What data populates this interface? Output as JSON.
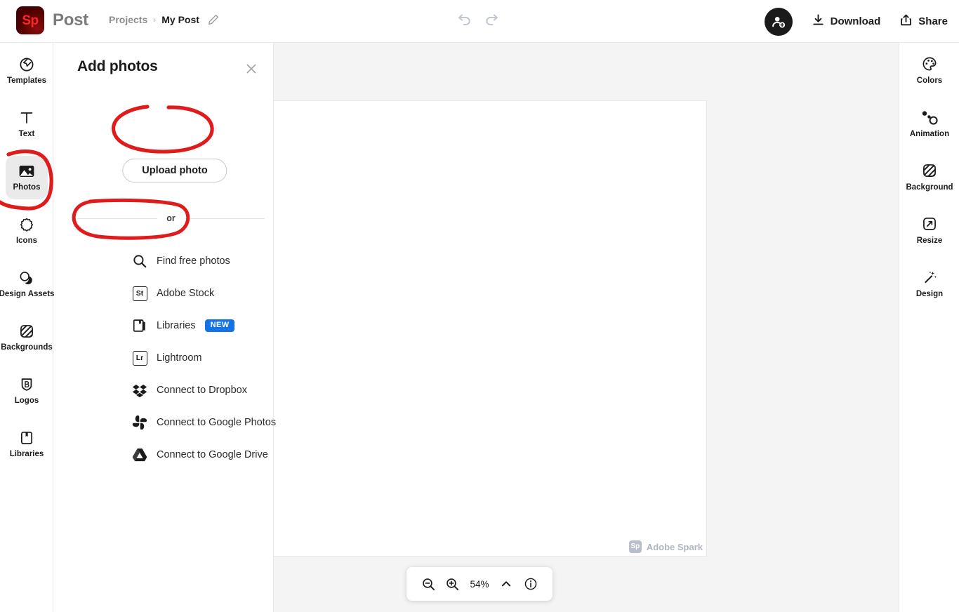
{
  "app": {
    "logo_text": "Sp",
    "brand_name": "Post",
    "logo_color": "#4d0000",
    "accent_color": "#fa2727"
  },
  "breadcrumb": {
    "root": "Projects",
    "separator": "›",
    "current": "My Post",
    "edit_icon": "pencil-icon"
  },
  "history": {
    "undo_icon": "undo-arrow-icon",
    "redo_icon": "redo-arrow-icon",
    "icon_color": "#c2c8d0"
  },
  "topbar": {
    "avatar_icon": "add-person-icon",
    "download_label": "Download",
    "download_icon": "download-icon",
    "share_label": "Share",
    "share_icon": "share-icon"
  },
  "left_rail": {
    "items": [
      {
        "label": "Templates",
        "icon": "templates-icon",
        "active": false
      },
      {
        "label": "Text",
        "icon": "text-T-icon",
        "active": false
      },
      {
        "label": "Photos",
        "icon": "photo-mountain-icon",
        "active": true
      },
      {
        "label": "Icons",
        "icon": "gear-badge-icon",
        "active": false
      },
      {
        "label": "Design Assets",
        "icon": "design-assets-icon",
        "active": false
      },
      {
        "label": "Backgrounds",
        "icon": "hatched-square-icon",
        "active": false
      },
      {
        "label": "Logos",
        "icon": "logo-shield-icon",
        "active": false
      },
      {
        "label": "Libraries",
        "icon": "bookmark-book-icon",
        "active": false
      }
    ]
  },
  "panel": {
    "title": "Add photos",
    "close_icon": "close-x-icon",
    "upload_label": "Upload photo",
    "divider_label": "or",
    "options": [
      {
        "label": "Find free photos",
        "icon": "search-icon",
        "badge": null
      },
      {
        "label": "Adobe Stock",
        "icon": "adobe-stock-St-icon",
        "badge": null,
        "icon_text": "St"
      },
      {
        "label": "Libraries",
        "icon": "libraries-book-icon",
        "badge": "NEW"
      },
      {
        "label": "Lightroom",
        "icon": "lightroom-Lr-icon",
        "badge": null,
        "icon_text": "Lr"
      },
      {
        "label": "Connect to Dropbox",
        "icon": "dropbox-icon",
        "badge": null
      },
      {
        "label": "Connect to Google Photos",
        "icon": "google-photos-pinwheel-icon",
        "badge": null
      },
      {
        "label": "Connect to Google Drive",
        "icon": "google-drive-icon",
        "badge": null
      }
    ],
    "badge_color": "#1473e6"
  },
  "canvas": {
    "watermark_badge": "Sp",
    "watermark_text": "Adobe Spark",
    "background_color": "#f4f4f4",
    "sheet_color": "#ffffff"
  },
  "zoombar": {
    "zoom_out_icon": "zoom-out-icon",
    "zoom_in_icon": "zoom-in-icon",
    "zoom_value": "54%",
    "chevron_icon": "chevron-up-icon",
    "info_icon": "info-circle-icon"
  },
  "right_rail": {
    "items": [
      {
        "label": "Colors",
        "icon": "color-palette-icon"
      },
      {
        "label": "Animation",
        "icon": "animation-icon"
      },
      {
        "label": "Background",
        "icon": "hatched-square-icon"
      },
      {
        "label": "Resize",
        "icon": "resize-arrow-icon"
      },
      {
        "label": "Design",
        "icon": "magic-wand-icon"
      }
    ]
  },
  "annotations": {
    "color": "#e01b1b",
    "marks": [
      {
        "name": "photos-rail-circle",
        "target": "Photos"
      },
      {
        "name": "upload-photo-circle",
        "target": "Upload photo"
      },
      {
        "name": "find-free-photos-circle",
        "target": "Find free photos"
      }
    ]
  }
}
